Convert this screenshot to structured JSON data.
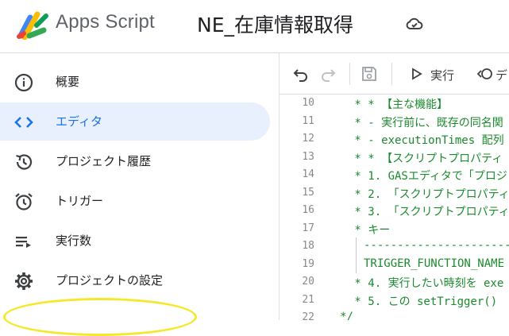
{
  "header": {
    "app_title": "Apps Script",
    "project_title": "NE_在庫情報取得",
    "icons": {
      "logo": "apps-script-logo",
      "cloud": "cloud-sync-icon"
    }
  },
  "sidebar": {
    "items": [
      {
        "label": "概要",
        "icon": "info-icon",
        "active": false
      },
      {
        "label": "エディタ",
        "icon": "code-icon",
        "active": true
      },
      {
        "label": "プロジェクト履歴",
        "icon": "history-icon",
        "active": false
      },
      {
        "label": "トリガー",
        "icon": "alarm-icon",
        "active": false
      },
      {
        "label": "実行数",
        "icon": "executions-icon",
        "active": false
      },
      {
        "label": "プロジェクトの設定",
        "icon": "gear-icon",
        "active": false
      }
    ]
  },
  "toolbar": {
    "run_label": "実行",
    "debug_label": "デ"
  },
  "editor": {
    "lines": [
      {
        "num": "10",
        "text": " * * 【主な機能】"
      },
      {
        "num": "11",
        "text": " * - 実行前に、既存の同名関"
      },
      {
        "num": "12",
        "text": " * - executionTimes 配列"
      },
      {
        "num": "13",
        "text": " * * 【スクリプトプロパティ"
      },
      {
        "num": "14",
        "text": " * 1. GASエディタで「プロジ"
      },
      {
        "num": "15",
        "text": " * 2. 「スクリプトプロパティ"
      },
      {
        "num": "16",
        "text": " * 3. 「スクリプトプロパティ"
      },
      {
        "num": "17",
        "text": " * キー"
      },
      {
        "num": "18",
        "text": "-----------------------"
      },
      {
        "num": "19",
        "text": "TRIGGER_FUNCTION_NAME"
      },
      {
        "num": "20",
        "text": " * 4. 実行したい時刻を exe"
      },
      {
        "num": "21",
        "text": " * 5. この setTrigger() "
      },
      {
        "num": "22",
        "text": "*/"
      }
    ]
  },
  "colors": {
    "accent": "#1a73e8",
    "active_bg": "#e8f0fe",
    "comment": "#1b8a2e",
    "highlight": "#f5e82a"
  }
}
